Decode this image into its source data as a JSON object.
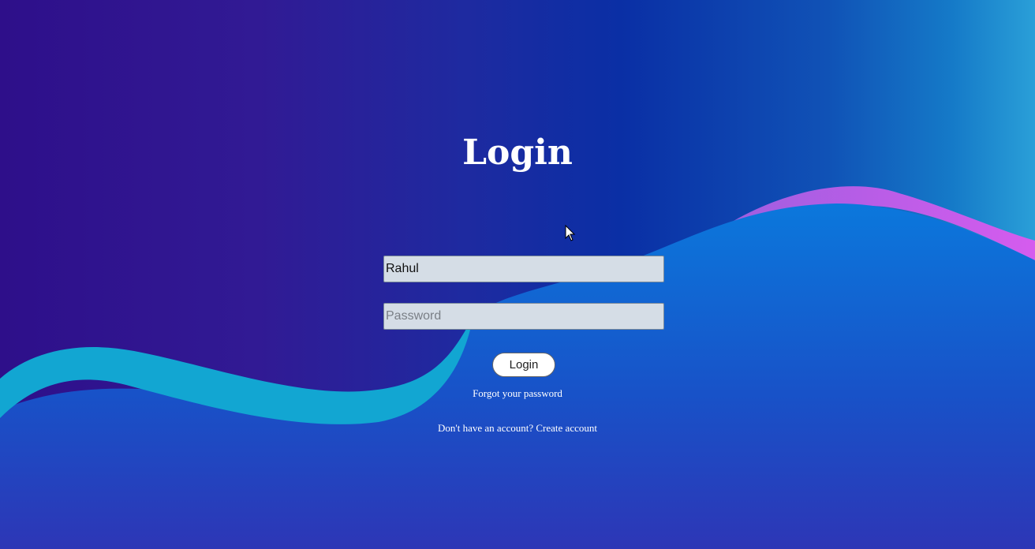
{
  "page": {
    "title": "Login"
  },
  "form": {
    "username_value": "Rahul",
    "password_placeholder": "Password",
    "login_button": "Login",
    "forgot_link": "Forgot your password",
    "signup_prompt": "Don't have an account?",
    "signup_link": "Create account"
  },
  "colors": {
    "background_left": "#2e0f8a",
    "background_right": "#2a9fd8",
    "wave_blue": "#0a7fe0",
    "wave_cyan": "#12a8d4",
    "wave_pink": "#c45ce8",
    "input_bg": "#d5dde6",
    "text": "#ffffff"
  },
  "icons": {
    "cursor": "mouse-pointer-icon"
  }
}
